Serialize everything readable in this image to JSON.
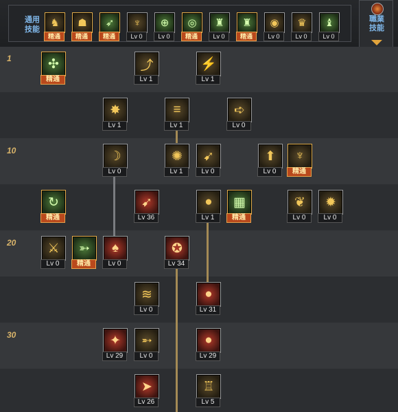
{
  "top_bar": {
    "common_skills_label": "通用\n技能",
    "job_skills_label": "職業\n技能",
    "common_skills": [
      {
        "icon": "leap-icon",
        "glyph": "♞",
        "color": "gold",
        "badge": "精通"
      },
      {
        "icon": "crouch-icon",
        "glyph": "☗",
        "color": "gold",
        "badge": "精通"
      },
      {
        "icon": "dash-icon",
        "glyph": "➶",
        "color": "green",
        "badge": "精通"
      },
      {
        "icon": "wings-icon",
        "glyph": "♆",
        "color": "gold",
        "badge": "Lv 0"
      },
      {
        "icon": "crosshair-icon",
        "glyph": "⊕",
        "color": "green",
        "badge": "Lv 0"
      },
      {
        "icon": "target-icon",
        "glyph": "◎",
        "color": "green",
        "badge": "精通"
      },
      {
        "icon": "soldier-icon",
        "glyph": "♜",
        "color": "green",
        "badge": "Lv 0"
      },
      {
        "icon": "soldier-gear-icon",
        "glyph": "♜",
        "color": "green",
        "badge": "精通"
      },
      {
        "icon": "eye-icon",
        "glyph": "◉",
        "color": "gold",
        "badge": "Lv 0"
      },
      {
        "icon": "power-icon",
        "glyph": "♛",
        "color": "gold",
        "badge": "Lv 0"
      },
      {
        "icon": "figure-icon",
        "glyph": "♝",
        "color": "green",
        "badge": "Lv 0"
      }
    ]
  },
  "level_markers": [
    {
      "label": "1"
    },
    {
      "label": "10"
    },
    {
      "label": "20"
    },
    {
      "label": "30"
    }
  ],
  "skills": [
    {
      "id": "s1",
      "icon": "scatter-icon",
      "glyph": "✣",
      "color": "green",
      "badge": "精通"
    },
    {
      "id": "s2",
      "icon": "uppercut-icon",
      "glyph": "⤴",
      "color": "gold",
      "badge": "Lv 1"
    },
    {
      "id": "s3",
      "icon": "kick-icon",
      "glyph": "⚡",
      "color": "gold",
      "badge": "Lv 1"
    },
    {
      "id": "s4",
      "icon": "burst-icon",
      "glyph": "✸",
      "color": "gold",
      "badge": "Lv 1"
    },
    {
      "id": "s5",
      "icon": "rapid-fire-icon",
      "glyph": "≡",
      "color": "gold",
      "badge": "Lv 1"
    },
    {
      "id": "s6",
      "icon": "bullet-icon",
      "glyph": "➪",
      "color": "gold",
      "badge": "Lv 0"
    },
    {
      "id": "s7",
      "icon": "slash-icon",
      "glyph": "☽",
      "color": "gold",
      "badge": "Lv 0"
    },
    {
      "id": "s8",
      "icon": "shot-burst-icon",
      "glyph": "✺",
      "color": "gold",
      "badge": "Lv 1"
    },
    {
      "id": "s9",
      "icon": "arrow-strike-icon",
      "glyph": "➹",
      "color": "gold",
      "badge": "Lv 0"
    },
    {
      "id": "s10",
      "icon": "uplift-icon",
      "glyph": "⬆",
      "color": "gold",
      "badge": "Lv 0"
    },
    {
      "id": "s11",
      "icon": "wolf-howl-icon",
      "glyph": "♆",
      "color": "gold",
      "badge": "精通"
    },
    {
      "id": "s12",
      "icon": "auto-reload-icon",
      "glyph": "↻",
      "color": "green",
      "badge": "精通"
    },
    {
      "id": "s13",
      "icon": "missile-icon",
      "glyph": "➹",
      "color": "red",
      "badge": "Lv 36"
    },
    {
      "id": "s14",
      "icon": "grenade-icon",
      "glyph": "●",
      "color": "gold",
      "badge": "Lv 1"
    },
    {
      "id": "s15",
      "icon": "barricade-icon",
      "glyph": "▦",
      "color": "green",
      "badge": "精通"
    },
    {
      "id": "s16",
      "icon": "wind-icon",
      "glyph": "❦",
      "color": "gold",
      "badge": "Lv 0"
    },
    {
      "id": "s17",
      "icon": "ground-blast-icon",
      "glyph": "✹",
      "color": "gold",
      "badge": "Lv 0"
    },
    {
      "id": "s18",
      "icon": "revolver-icon",
      "glyph": "⚔",
      "color": "gold",
      "badge": "Lv 0"
    },
    {
      "id": "s19",
      "icon": "crossbow-icon",
      "glyph": "➳",
      "color": "green",
      "badge": "精通"
    },
    {
      "id": "s20",
      "icon": "axe-icon",
      "glyph": "♠",
      "color": "red",
      "badge": "Lv 0"
    },
    {
      "id": "s21",
      "icon": "bomb-icon",
      "glyph": "✪",
      "color": "red",
      "badge": "Lv 34"
    },
    {
      "id": "s22",
      "icon": "claw-icon",
      "glyph": "≋",
      "color": "gold",
      "badge": "Lv 0"
    },
    {
      "id": "s23",
      "icon": "frag-grenade-icon",
      "glyph": "●",
      "color": "red",
      "badge": "Lv 31"
    },
    {
      "id": "s24",
      "icon": "flame-shot-icon",
      "glyph": "✦",
      "color": "red",
      "badge": "Lv 29"
    },
    {
      "id": "s25",
      "icon": "bow-icon",
      "glyph": "➵",
      "color": "gold",
      "badge": "Lv 0"
    },
    {
      "id": "s26",
      "icon": "napalm-icon",
      "glyph": "●",
      "color": "red",
      "badge": "Lv 29"
    },
    {
      "id": "s27",
      "icon": "rocket-icon",
      "glyph": "➤",
      "color": "red",
      "badge": "Lv 26"
    },
    {
      "id": "s28",
      "icon": "turret-icon",
      "glyph": "♖",
      "color": "gold",
      "badge": "Lv 5"
    }
  ]
}
